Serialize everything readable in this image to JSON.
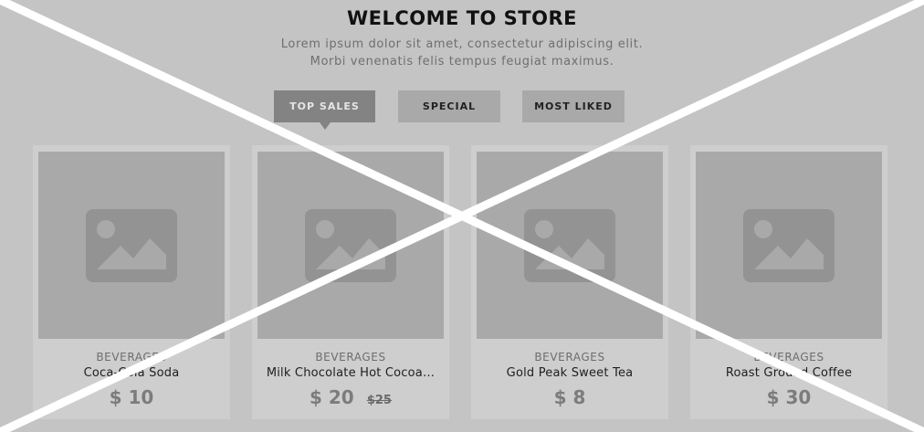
{
  "header": {
    "title": "WELCOME TO STORE",
    "subtitle_line1": "Lorem ipsum dolor sit amet, consectetur adipiscing elit.",
    "subtitle_line2": "Morbi venenatis felis tempus feugiat maximus."
  },
  "tabs": [
    {
      "label": "TOP SALES",
      "active": true
    },
    {
      "label": "SPECIAL",
      "active": false
    },
    {
      "label": "MOST LIKED",
      "active": false
    }
  ],
  "products": [
    {
      "category": "BEVERAGES",
      "name": "Coca-Cola Soda",
      "price": "$ 10",
      "old_price": ""
    },
    {
      "category": "BEVERAGES",
      "name": "Milk Chocolate Hot Cocoa…",
      "price": "$ 20",
      "old_price": "$25"
    },
    {
      "category": "BEVERAGES",
      "name": "Gold Peak Sweet Tea",
      "price": "$ 8",
      "old_price": ""
    },
    {
      "category": "BEVERAGES",
      "name": "Roast Ground Coffee",
      "price": "$ 30",
      "old_price": ""
    }
  ],
  "icons": {
    "product_image": "image-placeholder-icon"
  },
  "colors": {
    "background": "#c4c4c4",
    "active_tab": "#838383",
    "tab": "#a9a9a9",
    "card": "#cecece",
    "cross_overlay": "#ffffff"
  }
}
